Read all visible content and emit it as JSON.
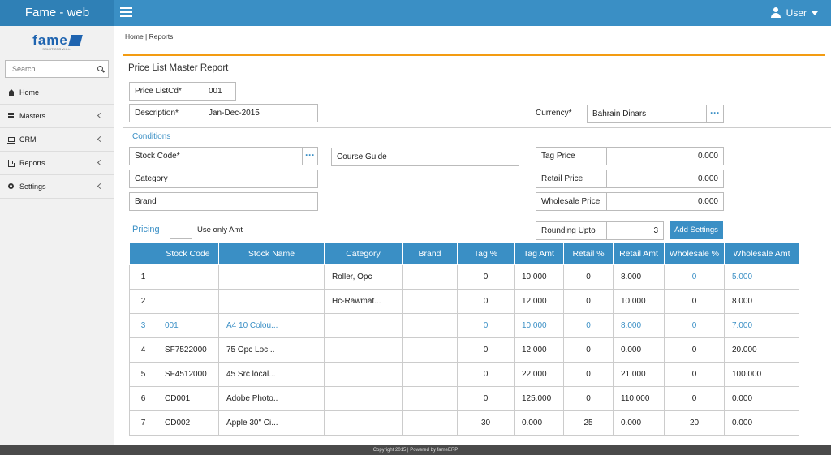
{
  "app": {
    "title": "Fame - web",
    "user_label": "User"
  },
  "logo": {
    "text": "fame",
    "sub": "SOLUTIONS W.L.L."
  },
  "search": {
    "placeholder": "Search..."
  },
  "sidebar": {
    "items": [
      {
        "label": "Home",
        "icon": "home-icon"
      },
      {
        "label": "Masters",
        "icon": "grid-icon"
      },
      {
        "label": "CRM",
        "icon": "laptop-icon"
      },
      {
        "label": "Reports",
        "icon": "bar-chart-icon"
      },
      {
        "label": "Settings",
        "icon": "gears-icon"
      }
    ]
  },
  "breadcrumb": "Home | Reports",
  "page_title": "Price List Master Report",
  "header_form": {
    "price_list_label": "Price ListCd*",
    "price_list_value": "001",
    "description_label": "Description*",
    "description_value": "Jan-Dec-2015",
    "currency_label": "Currency*",
    "currency_value": "Bahrain Dinars"
  },
  "conditions": {
    "title": "Conditions",
    "stock_code_label": "Stock Code*",
    "stock_code_value": "",
    "category_label": "Category",
    "category_value": "",
    "brand_label": "Brand",
    "brand_value": "",
    "course_guide": "Course Guide",
    "tag_price_label": "Tag Price",
    "tag_price_value": "0.000",
    "retail_price_label": "Retail Price",
    "retail_price_value": "0.000",
    "wholesale_price_label": "Wholesale Price",
    "wholesale_price_value": "0.000"
  },
  "pricing": {
    "title": "Pricing",
    "use_only_amt_label": "Use only Amt",
    "rounding_label": "Rounding Upto",
    "rounding_value": "3",
    "add_settings_label": "Add Settings"
  },
  "table": {
    "headers": [
      "",
      "Stock Code",
      "Stock Name",
      "Category",
      "Brand",
      "Tag %",
      "Tag Amt",
      "Retail %",
      "Retail Amt",
      "Wholesale %",
      "Wholesale Amt"
    ],
    "rows": [
      [
        "1",
        "",
        "",
        "Roller, Opc",
        "",
        "0",
        "10.000",
        "0",
        "8.000",
        "0",
        "5.000"
      ],
      [
        "2",
        "",
        "",
        "Hc-Rawmat...",
        "",
        "0",
        "12.000",
        "0",
        "10.000",
        "0",
        "8.000"
      ],
      [
        "3",
        "001",
        "A4 10 Colou...",
        "",
        "",
        "0",
        "10.000",
        "0",
        "8.000",
        "0",
        "7.000"
      ],
      [
        "4",
        "SF7522000",
        "75 Opc Loc...",
        "",
        "",
        "0",
        "12.000",
        "0",
        "0.000",
        "0",
        "20.000"
      ],
      [
        "5",
        "SF4512000",
        "45 Src local...",
        "",
        "",
        "0",
        "22.000",
        "0",
        "21.000",
        "0",
        "100.000"
      ],
      [
        "6",
        "CD001",
        "Adobe Photo..",
        "",
        "",
        "0",
        "125.000",
        "0",
        "110.000",
        "0",
        "0.000"
      ],
      [
        "7",
        "CD002",
        "Apple 30\" Ci...",
        "",
        "",
        "30",
        "0.000",
        "25",
        "0.000",
        "20",
        "0.000"
      ]
    ]
  },
  "footer": "Copyright 2015 | Powered by fameERP"
}
